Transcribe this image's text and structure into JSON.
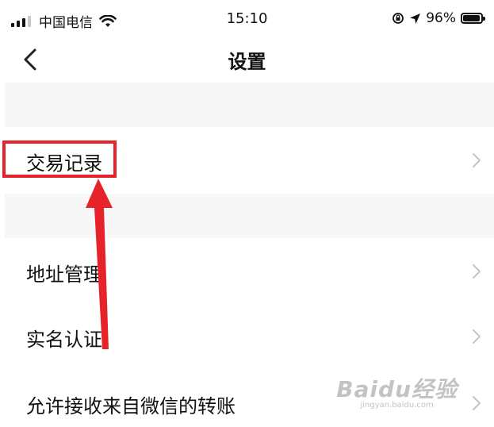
{
  "status_bar": {
    "carrier": "中国电信",
    "time": "15:10",
    "battery_percent": "96%",
    "battery_level": 0.96
  },
  "nav": {
    "title": "设置"
  },
  "settings": {
    "items": [
      {
        "label": "交易记录"
      },
      {
        "label": "地址管理"
      },
      {
        "label": "实名认证"
      },
      {
        "label": "允许接收来自微信的转账"
      }
    ]
  },
  "watermark": {
    "logo": "Baidu经验",
    "url": "jingyan.baidu.com"
  },
  "colors": {
    "highlight": "#e6232b",
    "section_gap": "#f7f7f7",
    "chevron": "#c4c4c4"
  }
}
